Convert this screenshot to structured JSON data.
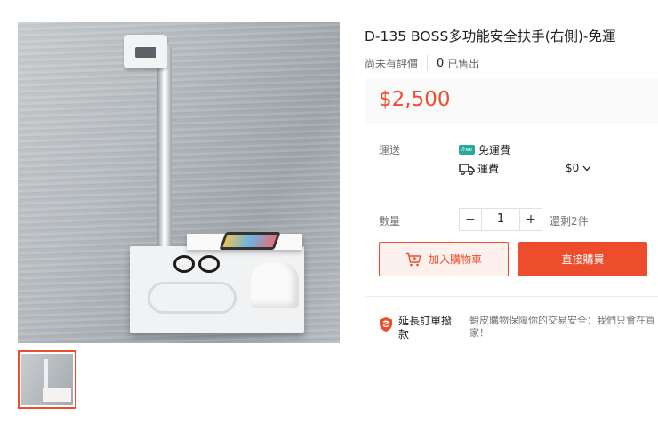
{
  "product": {
    "title": "D-135 BOSS多功能安全扶手(右側)-免運",
    "rating_text": "尚未有評價",
    "sold_count": "0",
    "sold_label": "已售出",
    "price": "$2,500"
  },
  "shipping": {
    "label": "運送",
    "free_badge": "free",
    "free_text": "免運費",
    "fee_label": "運費",
    "fee_value": "$0"
  },
  "quantity": {
    "label": "數量",
    "minus": "−",
    "value": "1",
    "plus": "+",
    "stock": "還剩2件"
  },
  "actions": {
    "add_to_cart": "加入購物車",
    "buy_now": "直接購買"
  },
  "guarantee": {
    "title": "延長訂單撥款",
    "text": "蝦皮購物保障你的交易安全：我們只會在買家！"
  },
  "colors": {
    "accent": "#ee4d2d",
    "free_ship": "#26aa99"
  }
}
